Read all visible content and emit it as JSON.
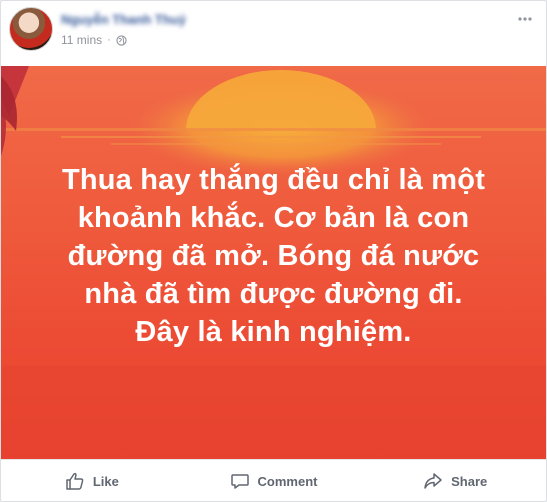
{
  "post": {
    "author_name": "Nguyễn Thanh Thuỷ",
    "timestamp": "11 mins",
    "separator": "·",
    "privacy_icon": "globe-icon",
    "menu_icon": "more-options-icon",
    "text_lines": [
      "Thua hay thắng đều chỉ là một",
      "khoảnh khắc. Cơ bản là con",
      "đường đã mở. Bóng đá nước",
      "nhà đã tìm được đường đi.",
      "Đây là kinh nghiệm."
    ],
    "background_colors": {
      "top": "#f06a48",
      "bottom": "#e8432f",
      "sun": "#f7b23a"
    }
  },
  "actions": {
    "like_label": "Like",
    "comment_label": "Comment",
    "share_label": "Share",
    "like_icon": "thumbs-up-icon",
    "comment_icon": "comment-bubble-icon",
    "share_icon": "share-arrow-icon"
  },
  "colors": {
    "link": "#365899",
    "muted": "#90949c",
    "action_text": "#606770"
  }
}
